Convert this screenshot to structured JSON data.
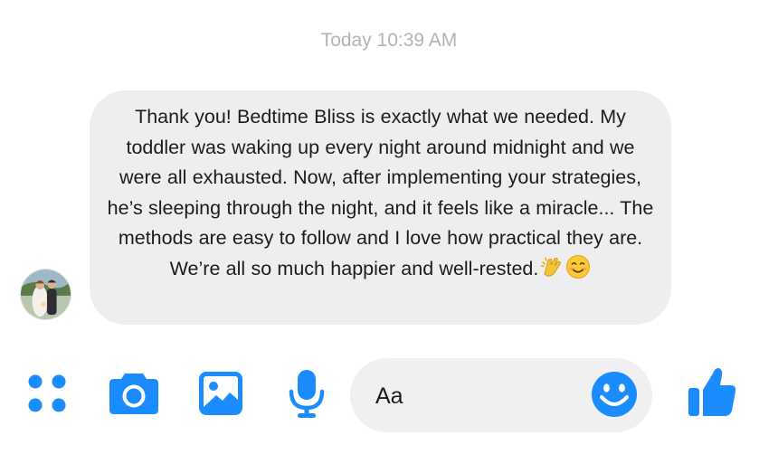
{
  "conversation": {
    "timestamp": "Today 10:39 AM",
    "message": {
      "text": "Thank you! Bedtime Bliss is exactly what we needed. My toddler was waking up every night around midnight and we were all exhausted. Now, after implementing your strategies, he’s sleeping through the night, and it feels like a miracle... The methods are easy to follow and I love how practical they are. We’re all so much happier and well-rested.",
      "emojis": [
        "clapping-hands",
        "smiling-face"
      ]
    }
  },
  "composer": {
    "placeholder": "Aa"
  },
  "toolbar": {
    "icons": [
      "apps-icon",
      "camera-icon",
      "gallery-icon",
      "microphone-icon",
      "emoji-icon",
      "thumbs-up-icon"
    ]
  },
  "colors": {
    "accent": "#1a8cff",
    "bubble": "#eeeef0",
    "timestamp": "#b4b4b7"
  }
}
